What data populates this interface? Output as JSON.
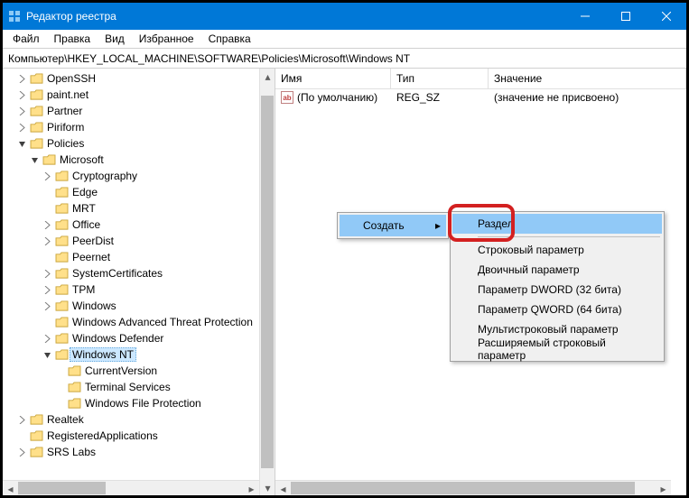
{
  "window": {
    "title": "Редактор реестра"
  },
  "menu": {
    "file": "Файл",
    "edit": "Правка",
    "view": "Вид",
    "fav": "Избранное",
    "help": "Справка"
  },
  "address": "Компьютер\\HKEY_LOCAL_MACHINE\\SOFTWARE\\Policies\\Microsoft\\Windows NT",
  "cols": {
    "name": "Имя",
    "type": "Тип",
    "value": "Значение"
  },
  "rows": [
    {
      "name": "(По умолчанию)",
      "type": "REG_SZ",
      "value": "(значение не присвоено)"
    }
  ],
  "tree": {
    "openssh": "OpenSSH",
    "paint": "paint.net",
    "partner": "Partner",
    "piriform": "Piriform",
    "policies": "Policies",
    "microsoft": "Microsoft",
    "crypto": "Cryptography",
    "edge": "Edge",
    "mrt": "MRT",
    "office": "Office",
    "peerdist": "PeerDist",
    "peernet": "Peernet",
    "syscert": "SystemCertificates",
    "tpm": "TPM",
    "windows": "Windows",
    "watp": "Windows Advanced Threat Protection",
    "wdef": "Windows Defender",
    "wnt": "Windows NT",
    "curver": "CurrentVersion",
    "termserv": "Terminal Services",
    "wfp": "Windows File Protection",
    "realtek": "Realtek",
    "regapps": "RegisteredApplications",
    "srslabs": "SRS Labs"
  },
  "ctx": {
    "create": "Создать",
    "key": "Раздел",
    "str": "Строковый параметр",
    "bin": "Двоичный параметр",
    "dword": "Параметр DWORD (32 бита)",
    "qword": "Параметр QWORD (64 бита)",
    "multi": "Мультистроковый параметр",
    "exp": "Расширяемый строковый параметр"
  }
}
